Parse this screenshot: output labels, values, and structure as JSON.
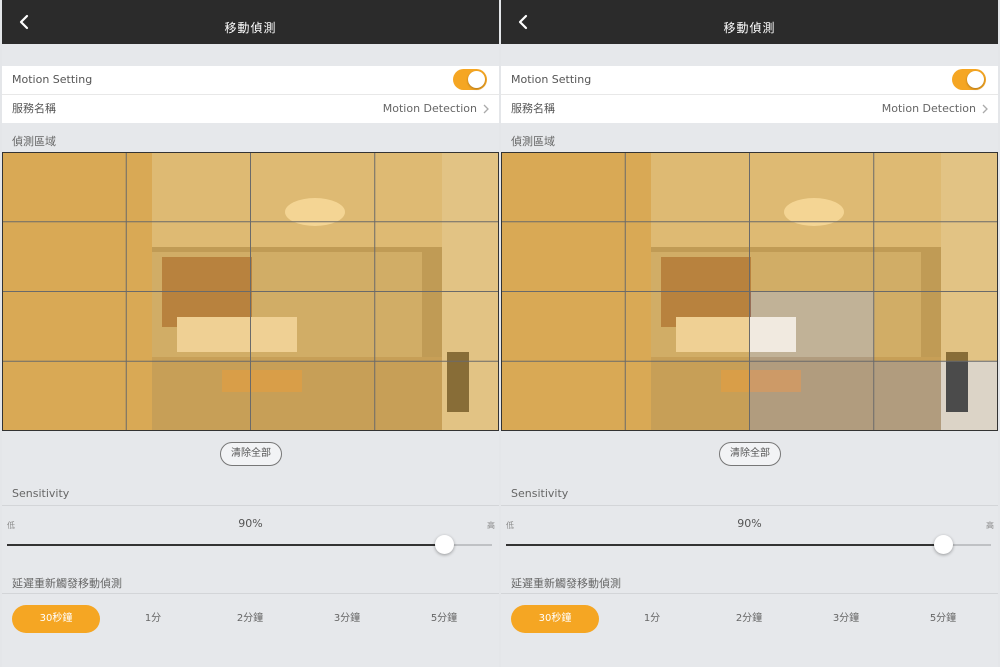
{
  "screens": [
    {
      "header": {
        "title": "移動偵測",
        "back_icon": "chevron-left-icon"
      },
      "motion_setting": {
        "label": "Motion Setting",
        "enabled": true
      },
      "service_name": {
        "label": "服務名稱",
        "value": "Motion Detection"
      },
      "detection_area": {
        "label": "偵測區域",
        "grid_columns": 4,
        "grid_rows": 4,
        "selected_cells": [
          [
            true,
            true,
            true,
            true
          ],
          [
            true,
            true,
            true,
            true
          ],
          [
            true,
            true,
            true,
            true
          ],
          [
            true,
            true,
            true,
            true
          ]
        ]
      },
      "clear_all_label": "清除全部",
      "sensitivity": {
        "label": "Sensitivity",
        "low_label": "低",
        "high_label": "高",
        "value_text": "90%",
        "level": 0.9
      },
      "retrigger": {
        "label": "延遲重新觸發移動偵測",
        "options": [
          "30秒鐘",
          "1分",
          "2分鐘",
          "3分鐘",
          "5分鐘"
        ],
        "selected_index": 0
      }
    },
    {
      "header": {
        "title": "移動偵測",
        "back_icon": "chevron-left-icon"
      },
      "motion_setting": {
        "label": "Motion Setting",
        "enabled": true
      },
      "service_name": {
        "label": "服務名稱",
        "value": "Motion Detection"
      },
      "detection_area": {
        "label": "偵測區域",
        "grid_columns": 4,
        "grid_rows": 4,
        "selected_cells": [
          [
            true,
            true,
            true,
            true
          ],
          [
            true,
            true,
            true,
            true
          ],
          [
            true,
            true,
            false,
            true
          ],
          [
            true,
            true,
            false,
            false
          ]
        ]
      },
      "clear_all_label": "清除全部",
      "sensitivity": {
        "label": "Sensitivity",
        "low_label": "低",
        "high_label": "高",
        "value_text": "90%",
        "level": 0.9
      },
      "retrigger": {
        "label": "延遲重新觸發移動偵測",
        "options": [
          "30秒鐘",
          "1分",
          "2分鐘",
          "3分鐘",
          "5分鐘"
        ],
        "selected_index": 0
      }
    }
  ],
  "colors": {
    "accent": "#f5a623",
    "header_bg": "#2b2b2b",
    "overlay": "#f0b43c"
  }
}
